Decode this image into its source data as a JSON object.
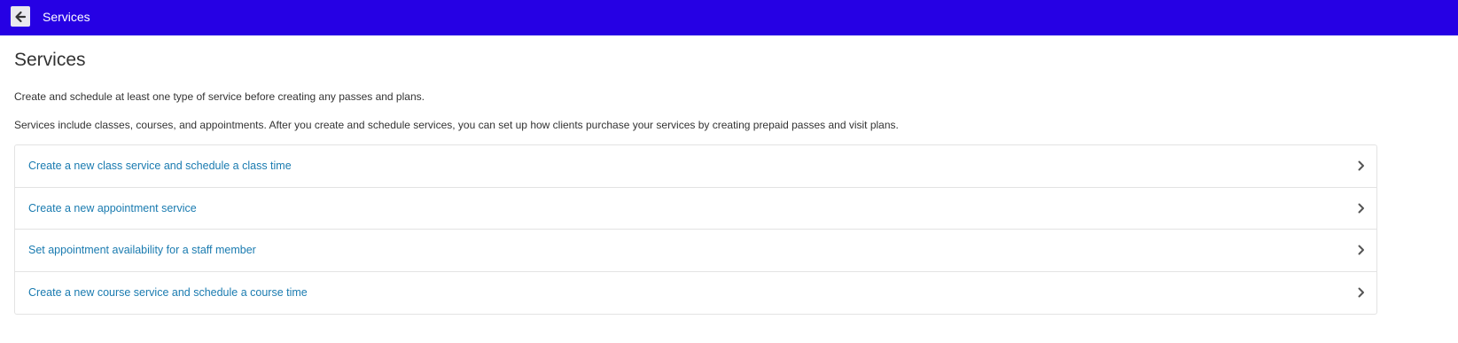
{
  "topbar": {
    "title": "Services",
    "back_icon": "arrow-left-icon",
    "background_color": "#2600e4"
  },
  "main": {
    "title": "Services",
    "paragraphs": [
      "Create and schedule at least one type of service before creating any passes and plans.",
      "Services include classes, courses, and appointments. After you create and schedule services, you can set up how clients purchase your services by creating prepaid passes and visit plans."
    ],
    "items": [
      {
        "label": "Create a new class service and schedule a class time",
        "icon": "chevron-right-icon"
      },
      {
        "label": "Create a new appointment service",
        "icon": "chevron-right-icon"
      },
      {
        "label": "Set appointment availability for a staff member",
        "icon": "chevron-right-icon"
      },
      {
        "label": "Create a new course service and schedule a course time",
        "icon": "chevron-right-icon"
      }
    ],
    "link_color": "#1a7bb0"
  }
}
